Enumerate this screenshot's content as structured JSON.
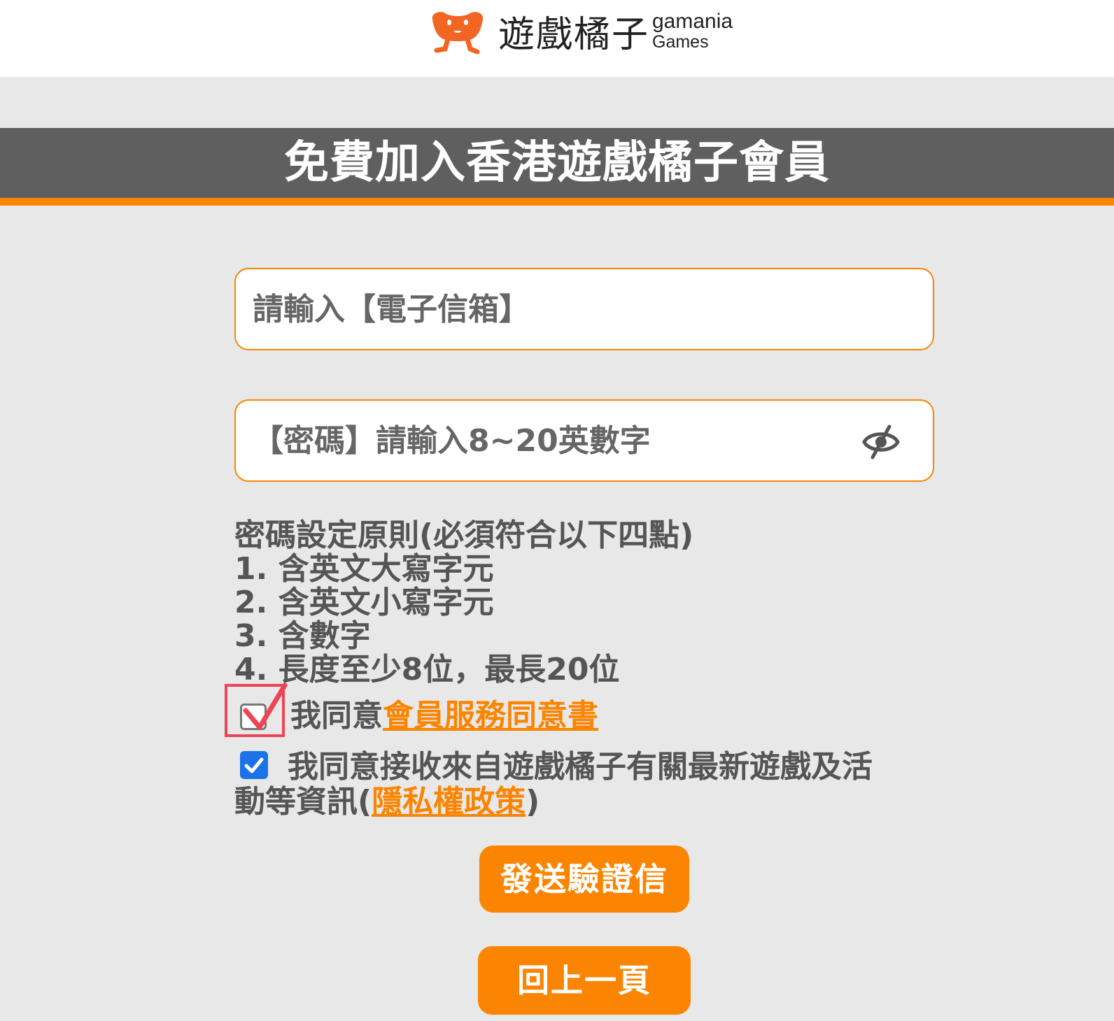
{
  "header": {
    "logo_cn": "遊戲橘子",
    "logo_en_line1": "gamania",
    "logo_en_line2": "Games"
  },
  "title": "免費加入香港遊戲橘子會員",
  "form": {
    "email_placeholder": "請輸入【電子信箱】",
    "email_value": "",
    "password_placeholder": "【密碼】請輸入8~20英數字",
    "password_value": "",
    "password_toggle_icon": "eye-slash-icon"
  },
  "password_rules": {
    "heading": "密碼設定原則(必須符合以下四點)",
    "items": [
      "1. 含英文大寫字元",
      "2. 含英文小寫字元",
      "3. 含數字",
      "4. 長度至少8位，最長20位"
    ]
  },
  "agreement": {
    "checked": false,
    "prefix": "我同意",
    "link": "會員服務同意書"
  },
  "consent": {
    "checked": true,
    "line1": "我同意接收來自遊戲橘子有關最新遊戲及活",
    "line2_prefix": "動等資訊(",
    "link": "隱私權政策",
    "line2_suffix": ")"
  },
  "buttons": {
    "send": "發送驗證信",
    "back": "回上一頁"
  },
  "colors": {
    "accent": "#fb8500",
    "title_band": "#5f5f5f",
    "background": "#e8e8e8",
    "checkbox_checked": "#1a73e8",
    "highlight": "#ee4455"
  }
}
